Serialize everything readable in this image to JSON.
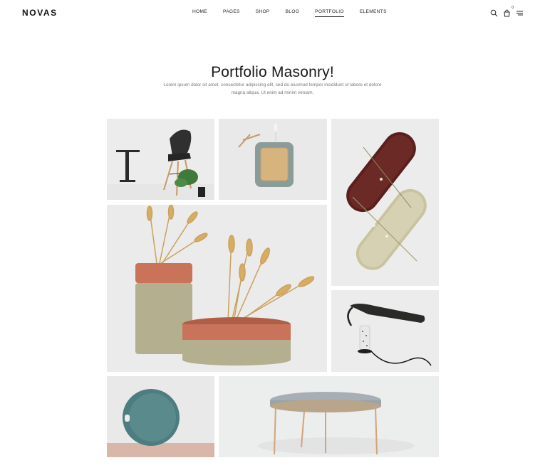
{
  "header": {
    "logo": "NOVAS",
    "nav": [
      {
        "label": "HOME"
      },
      {
        "label": "PAGES"
      },
      {
        "label": "SHOP"
      },
      {
        "label": "BLOG"
      },
      {
        "label": "PORTFOLIO",
        "active": true
      },
      {
        "label": "ELEMENTS"
      }
    ],
    "cart_count": "0",
    "icons": [
      "search-icon",
      "cart-icon",
      "menu-icon"
    ]
  },
  "main": {
    "title": "Portfolio Masonry!",
    "description": "Lorem ipsum dolor sit amet, consectetur adipiscing elit, sed do eiusmod tempor incididunt ut labore et dolore magna aliqua. Ut enim ad minim veniam."
  },
  "portfolio": {
    "items": [
      {
        "name": "chair-and-side-table",
        "icon": "chair-image"
      },
      {
        "name": "wooden-wall-lamp",
        "icon": "lamp-image"
      },
      {
        "name": "oval-trays",
        "icon": "tray-image"
      },
      {
        "name": "wheat-vases",
        "icon": "vase-image"
      },
      {
        "name": "desk-lamp",
        "icon": "lamp-image"
      },
      {
        "name": "round-tray",
        "icon": "tray-image"
      },
      {
        "name": "round-coffee-table",
        "icon": "table-image"
      }
    ]
  },
  "colors": {
    "accent": "#222222",
    "tile_bg": "#e9e9e9",
    "terracotta": "#c8735a",
    "sage": "#b3af8f",
    "teal": "#5b8a8c"
  }
}
